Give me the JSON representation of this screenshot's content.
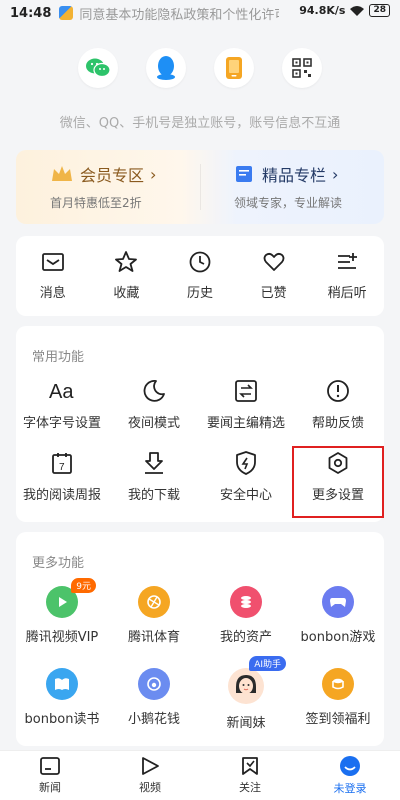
{
  "status": {
    "time": "14:48",
    "marquee": "同意基本功能隐私政策和个性化许可协议",
    "speed": "94.8K/s",
    "battery": "28"
  },
  "login": {
    "icons": [
      "wechat-icon",
      "qq-icon",
      "phone-icon",
      "qrcode-icon"
    ],
    "hint": "微信、QQ、手机号是独立账号，账号信息不互通"
  },
  "vip": {
    "title": "会员专区",
    "subtitle": "首月特惠低至2折"
  },
  "column": {
    "title": "精品专栏",
    "subtitle": "领域专家，专业解读"
  },
  "quick": [
    {
      "label": "消息",
      "icon": "message-icon"
    },
    {
      "label": "收藏",
      "icon": "star-icon"
    },
    {
      "label": "历史",
      "icon": "clock-icon"
    },
    {
      "label": "已赞",
      "icon": "heart-icon"
    },
    {
      "label": "稍后听",
      "icon": "playlist-icon"
    }
  ],
  "common": {
    "title": "常用功能",
    "items": [
      {
        "label": "字体字号设置",
        "icon": "font-icon"
      },
      {
        "label": "夜间模式",
        "icon": "moon-icon"
      },
      {
        "label": "要闻主编精选",
        "icon": "swap-icon"
      },
      {
        "label": "帮助反馈",
        "icon": "alert-icon"
      },
      {
        "label": "我的阅读周报",
        "icon": "calendar-icon"
      },
      {
        "label": "我的下载",
        "icon": "download-icon"
      },
      {
        "label": "安全中心",
        "icon": "shield-icon"
      },
      {
        "label": "更多设置",
        "icon": "settings-icon"
      }
    ]
  },
  "more": {
    "title": "更多功能",
    "items": [
      {
        "label": "腾讯视频VIP",
        "icon": "tencent-video-icon",
        "badge": "9元",
        "color": "#4cc36a"
      },
      {
        "label": "腾讯体育",
        "icon": "sports-icon",
        "color": "#f5a623"
      },
      {
        "label": "我的资产",
        "icon": "coins-icon",
        "color": "#f0506e"
      },
      {
        "label": "bonbon游戏",
        "icon": "gamepad-icon",
        "color": "#6b7cf0"
      },
      {
        "label": "bonbon读书",
        "icon": "book-icon",
        "color": "#3aa6f0"
      },
      {
        "label": "小鹅花钱",
        "icon": "goose-wallet-icon",
        "color": "#6b8cf0"
      },
      {
        "label": "新闻妹",
        "icon": "news-girl-avatar",
        "badge": "AI助手"
      },
      {
        "label": "签到领福利",
        "icon": "gift-coins-icon",
        "color": "#f5a623"
      }
    ]
  },
  "tabs": [
    {
      "label": "新闻",
      "icon": "news-icon"
    },
    {
      "label": "视频",
      "icon": "video-icon"
    },
    {
      "label": "关注",
      "icon": "follow-icon"
    },
    {
      "label": "未登录",
      "icon": "user-icon",
      "active": true
    }
  ],
  "accent": "#1a6ff0"
}
